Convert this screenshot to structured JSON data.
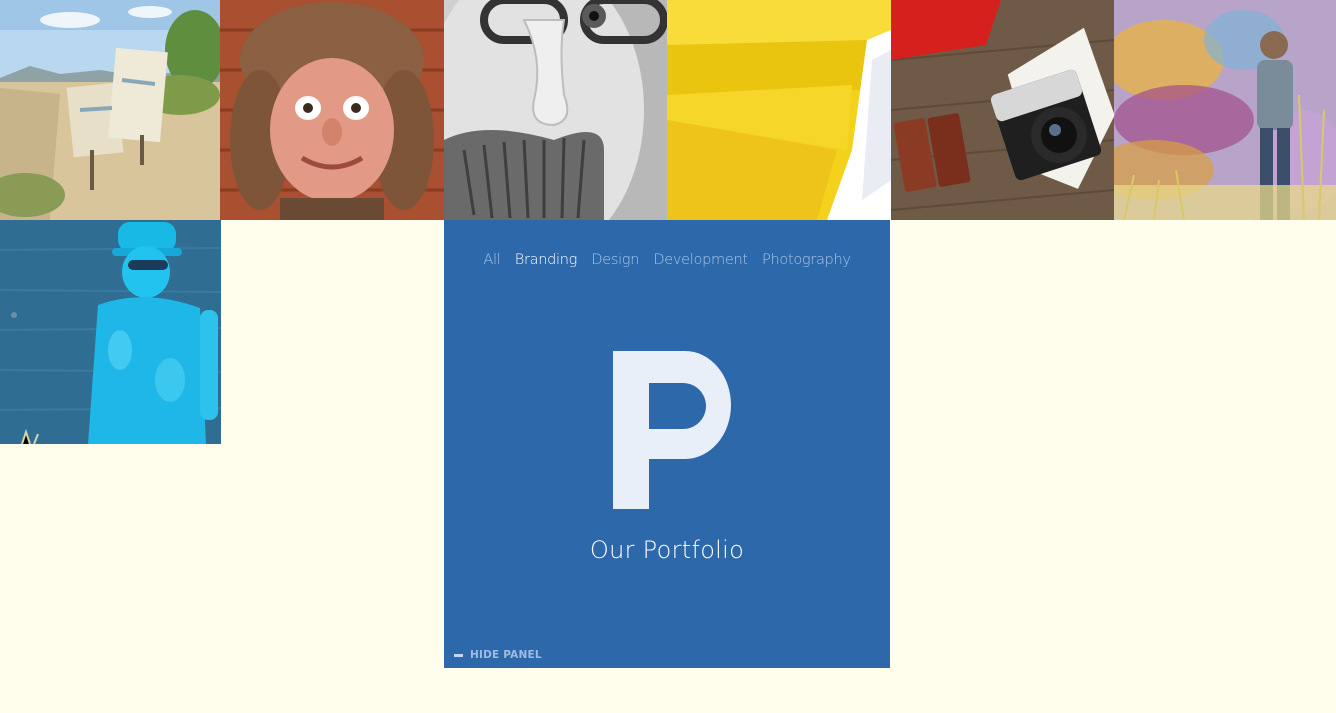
{
  "gallery": {
    "tiles": [
      {
        "name": "desert-range-signs-photo"
      },
      {
        "name": "fur-hat-man-photo"
      },
      {
        "name": "glasses-mustache-disguise-photo"
      },
      {
        "name": "yellow-paper-photo"
      },
      {
        "name": "camera-and-film-photo"
      },
      {
        "name": "graffiti-wall-man-photo"
      },
      {
        "name": "blue-powder-man-photo"
      }
    ]
  },
  "panel": {
    "filters": [
      "All",
      "Branding",
      "Design",
      "Development",
      "Photography"
    ],
    "active_filter": "Branding",
    "monogram": "P",
    "title": "Our Portfolio",
    "hide_label": "HIDE PANEL"
  },
  "colors": {
    "background": "#fffdeb",
    "panel": "#2d68ab",
    "filter_inactive": "#a9c4e8",
    "filter_active": "#ffffff",
    "monogram": "#e9eff8"
  }
}
